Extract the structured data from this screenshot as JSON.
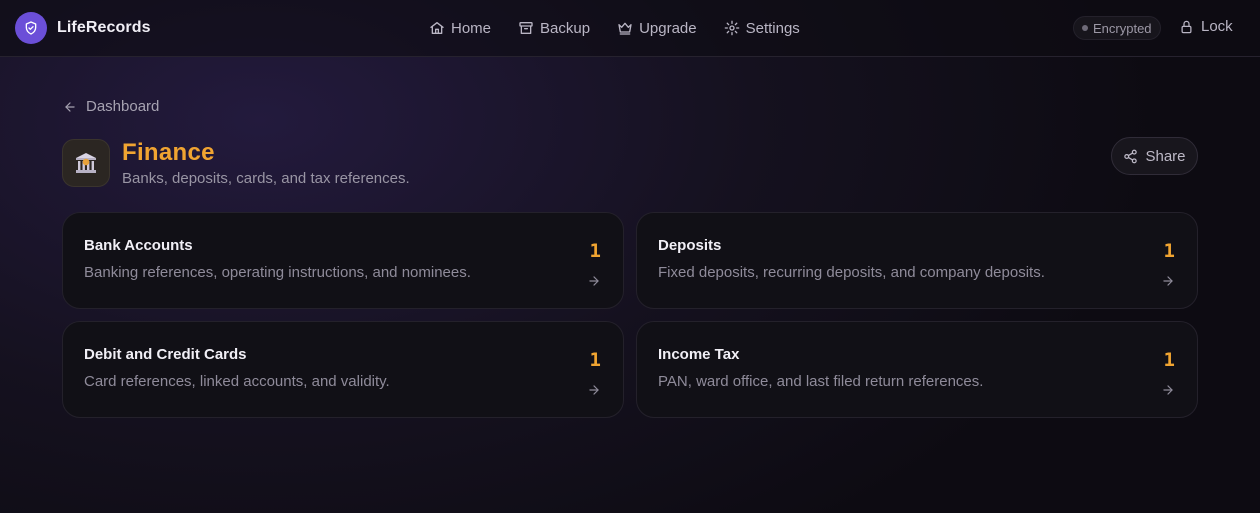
{
  "app": {
    "name": "LifeRecords"
  },
  "nav": [
    {
      "label": "Home",
      "icon": "home-icon"
    },
    {
      "label": "Backup",
      "icon": "archive-icon"
    },
    {
      "label": "Upgrade",
      "icon": "crown-icon"
    },
    {
      "label": "Settings",
      "icon": "gear-icon"
    }
  ],
  "status": {
    "encrypted_label": "Encrypted",
    "lock_label": "Lock"
  },
  "breadcrumb": {
    "back_label": "Dashboard"
  },
  "category": {
    "title": "Finance",
    "subtitle": "Banks, deposits, cards, and tax references.",
    "icon": "bank-icon",
    "share_label": "Share"
  },
  "cards": [
    {
      "title": "Bank Accounts",
      "desc": "Banking references, operating instructions, and nominees.",
      "count": "1"
    },
    {
      "title": "Deposits",
      "desc": "Fixed deposits, recurring deposits, and company deposits.",
      "count": "1"
    },
    {
      "title": "Debit and Credit Cards",
      "desc": "Card references, linked accounts, and validity.",
      "count": "1"
    },
    {
      "title": "Income Tax",
      "desc": "PAN, ward office, and last filed return references.",
      "count": "1"
    }
  ],
  "colors": {
    "accent": "#f0a431",
    "brand": "#6b4fd8",
    "background": "#15111f"
  }
}
